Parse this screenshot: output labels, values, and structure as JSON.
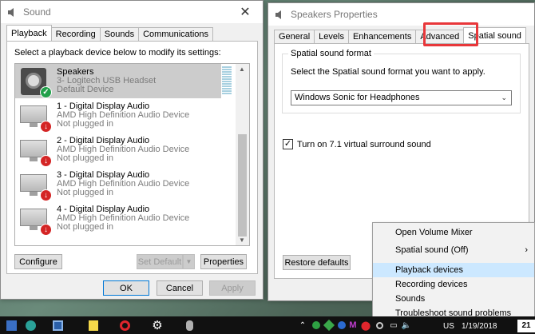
{
  "sound_window": {
    "title": "Sound",
    "tabs": [
      "Playback",
      "Recording",
      "Sounds",
      "Communications"
    ],
    "instruction": "Select a playback device below to modify its settings:",
    "devices": [
      {
        "name": "Speakers",
        "line2": "3- Logitech USB Headset",
        "line3": "Default Device",
        "status": "default"
      },
      {
        "name": "1 - Digital Display Audio",
        "line2": "AMD High Definition Audio Device",
        "line3": "Not plugged in",
        "status": "unplugged"
      },
      {
        "name": "2 - Digital Display Audio",
        "line2": "AMD High Definition Audio Device",
        "line3": "Not plugged in",
        "status": "unplugged"
      },
      {
        "name": "3 - Digital Display Audio",
        "line2": "AMD High Definition Audio Device",
        "line3": "Not plugged in",
        "status": "unplugged"
      },
      {
        "name": "4 - Digital Display Audio",
        "line2": "AMD High Definition Audio Device",
        "line3": "Not plugged in",
        "status": "unplugged"
      }
    ],
    "configure_label": "Configure",
    "set_default_label": "Set Default",
    "properties_label": "Properties",
    "ok_label": "OK",
    "cancel_label": "Cancel",
    "apply_label": "Apply"
  },
  "speakers_window": {
    "title": "Speakers Properties",
    "tabs": [
      "General",
      "Levels",
      "Enhancements",
      "Advanced",
      "Spatial sound"
    ],
    "group_title": "Spatial sound format",
    "group_desc": "Select the Spatial sound format you want to apply.",
    "format_selected": "Windows Sonic for Headphones",
    "checkbox_label": "Turn on 7.1 virtual surround sound",
    "checkbox_checked": true,
    "restore_label": "Restore defaults"
  },
  "context_menu": {
    "items": [
      "Open Volume Mixer",
      "Spatial sound (Off)",
      "Playback devices",
      "Recording devices",
      "Sounds",
      "Troubleshoot sound problems"
    ]
  },
  "taskbar": {
    "lang": "US",
    "date": "1/19/2018",
    "notification_count": "21"
  },
  "colors": {
    "accent": "#0078d7",
    "highlight": "#e8373a",
    "default_badge": "#21a04a",
    "unplugged_badge": "#d42525"
  }
}
